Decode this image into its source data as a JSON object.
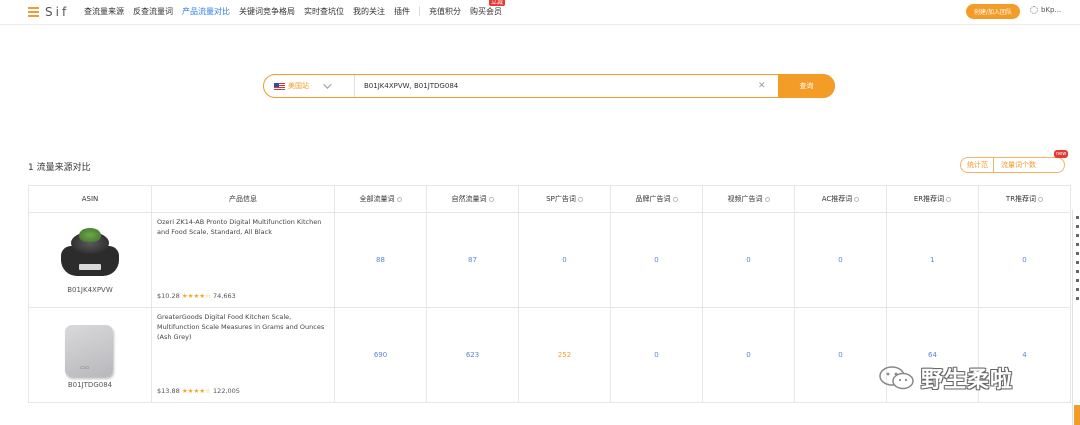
{
  "brand": {
    "logo_text": "Sif"
  },
  "nav": {
    "items": [
      {
        "label": "查流量来源",
        "active": false
      },
      {
        "label": "反查流量词",
        "active": false
      },
      {
        "label": "产品流量对比",
        "active": true
      },
      {
        "label": "关键词竞争格局",
        "active": false
      },
      {
        "label": "实时查坑位",
        "active": false
      },
      {
        "label": "我的关注",
        "active": false
      },
      {
        "label": "插件",
        "active": false
      }
    ],
    "extra": [
      {
        "label": "充值积分"
      },
      {
        "label": "购买会员",
        "badge": "立减"
      }
    ],
    "join_button": "创建/加入团队",
    "user_label": "bKp..."
  },
  "search": {
    "site": "美国站",
    "value": "B01JK4XPVW, B01JTDG084",
    "query_button": "查询"
  },
  "section": {
    "title": "1  流量来源对比",
    "stat_a": "统计范",
    "stat_b": "流量词个数",
    "stat_badge": "new"
  },
  "table": {
    "headers": [
      "ASIN",
      "产品信息",
      "全部流量词",
      "自然流量词",
      "SP广告词",
      "品牌广告词",
      "视频广告词",
      "AC推荐词",
      "ER推荐词",
      "TR推荐词"
    ],
    "rows": [
      {
        "asin": "B01JK4XPVW",
        "title": "Ozeri ZK14-AB Pronto Digital Multifunction Kitchen and Food Scale, Standard, All Black",
        "price": "$10.28",
        "stars": "★★★★☆",
        "reviews": "74,663",
        "values": [
          "88",
          "87",
          "0",
          "0",
          "0",
          "0",
          "1",
          "0"
        ]
      },
      {
        "asin": "B01JTDG084",
        "title": "GreaterGoods Digital Food Kitchen Scale, Multifunction Scale Measures in Grams and Ounces (Ash Grey)",
        "price": "$13.88",
        "stars": "★★★★☆",
        "reviews": "122,005",
        "values": [
          "690",
          "623",
          "252",
          "0",
          "0",
          "0",
          "64",
          "4"
        ]
      }
    ]
  },
  "watermark": {
    "text": "野生柔啦"
  },
  "colors": {
    "accent": "#f39c28",
    "link_blue": "#5a84d8",
    "active_nav": "#2f7fe6"
  }
}
